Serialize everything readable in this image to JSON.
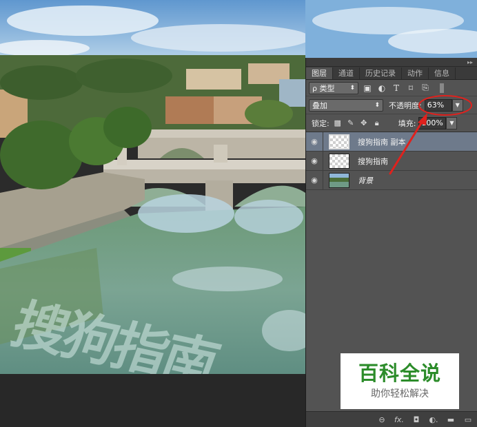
{
  "panel": {
    "tabs": [
      {
        "label": "图层",
        "active": true
      },
      {
        "label": "通道",
        "active": false
      },
      {
        "label": "历史记录",
        "active": false
      },
      {
        "label": "动作",
        "active": false
      },
      {
        "label": "信息",
        "active": false
      }
    ],
    "filter": {
      "label": "ρ 类型",
      "arrow": "⬍"
    },
    "blend_mode": {
      "value": "叠加",
      "arrow": "⬍"
    },
    "opacity": {
      "label": "不透明度:",
      "value": "63%"
    },
    "lock": {
      "label": "锁定:"
    },
    "fill": {
      "label": "填充:",
      "value": "100%"
    },
    "layers": [
      {
        "name": "搜狗指南 副本",
        "selected": true,
        "thumb": "transparent"
      },
      {
        "name": "搜狗指南",
        "selected": false,
        "thumb": "transparent"
      },
      {
        "name": "背景",
        "selected": false,
        "thumb": "photo"
      }
    ],
    "bottom_icons": [
      "link-icon",
      "fx-icon",
      "mask-icon",
      "adjustment-icon",
      "folder-icon",
      "new-layer-icon"
    ],
    "bottom_labels": {
      "link": "⊖",
      "fx": "fx.",
      "mask": "◘",
      "adjust": "◐.",
      "folder": "▬",
      "new": "▭"
    }
  },
  "photo_text": "搜狗指南",
  "watermark": {
    "title": "百科全说",
    "subtitle": "助你轻松解决"
  },
  "colors": {
    "annotation": "#e0211d",
    "selected_layer": "#6e7a8b",
    "watermark_green": "#2c8c2a"
  }
}
